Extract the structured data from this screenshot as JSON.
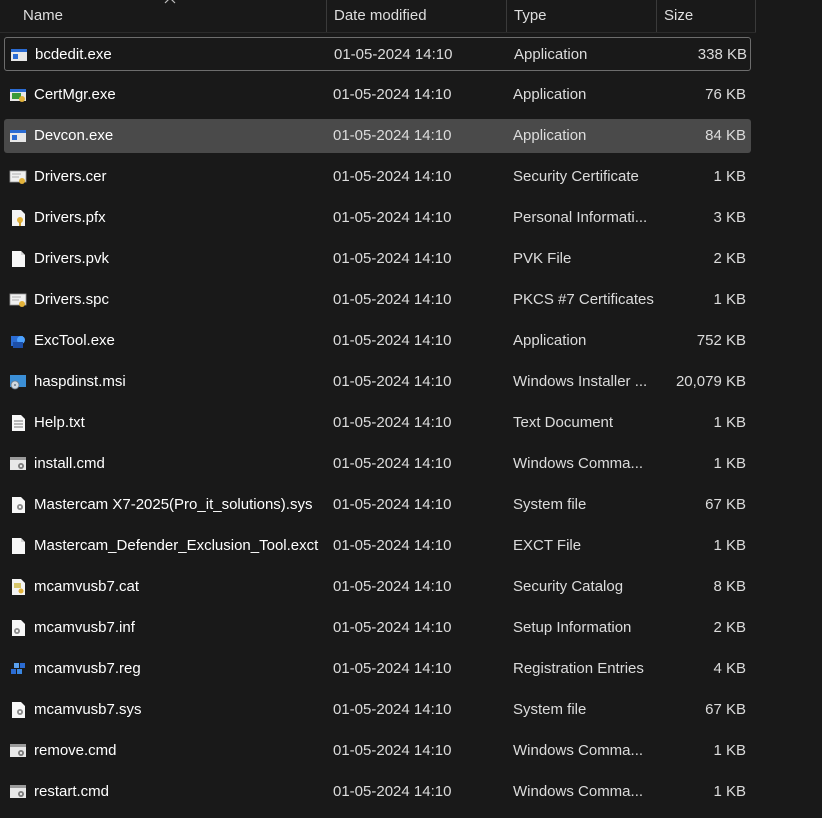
{
  "columns": {
    "name": "Name",
    "date": "Date modified",
    "type": "Type",
    "size": "Size"
  },
  "files": [
    {
      "name": "bcdedit.exe",
      "date": "01-05-2024 14:10",
      "type": "Application",
      "size": "338 KB",
      "icon": "exe-icon",
      "state": "focused"
    },
    {
      "name": "CertMgr.exe",
      "date": "01-05-2024 14:10",
      "type": "Application",
      "size": "76 KB",
      "icon": "certmgr-icon",
      "state": ""
    },
    {
      "name": "Devcon.exe",
      "date": "01-05-2024 14:10",
      "type": "Application",
      "size": "84 KB",
      "icon": "exe-icon",
      "state": "selected"
    },
    {
      "name": "Drivers.cer",
      "date": "01-05-2024 14:10",
      "type": "Security Certificate",
      "size": "1 KB",
      "icon": "certificate-icon",
      "state": ""
    },
    {
      "name": "Drivers.pfx",
      "date": "01-05-2024 14:10",
      "type": "Personal Informati...",
      "size": "3 KB",
      "icon": "pfx-icon",
      "state": ""
    },
    {
      "name": "Drivers.pvk",
      "date": "01-05-2024 14:10",
      "type": "PVK File",
      "size": "2 KB",
      "icon": "blank-file-icon",
      "state": ""
    },
    {
      "name": "Drivers.spc",
      "date": "01-05-2024 14:10",
      "type": "PKCS #7 Certificates",
      "size": "1 KB",
      "icon": "certificate-icon",
      "state": ""
    },
    {
      "name": "ExcTool.exe",
      "date": "01-05-2024 14:10",
      "type": "Application",
      "size": "752 KB",
      "icon": "exctool-icon",
      "state": ""
    },
    {
      "name": "haspdinst.msi",
      "date": "01-05-2024 14:10",
      "type": "Windows Installer ...",
      "size": "20,079 KB",
      "icon": "installer-icon",
      "state": ""
    },
    {
      "name": "Help.txt",
      "date": "01-05-2024 14:10",
      "type": "Text Document",
      "size": "1 KB",
      "icon": "text-file-icon",
      "state": ""
    },
    {
      "name": "install.cmd",
      "date": "01-05-2024 14:10",
      "type": "Windows Comma...",
      "size": "1 KB",
      "icon": "cmd-file-icon",
      "state": ""
    },
    {
      "name": "Mastercam X7-2025(Pro_it_solutions).sys",
      "date": "01-05-2024 14:10",
      "type": "System file",
      "size": "67 KB",
      "icon": "system-file-icon",
      "state": ""
    },
    {
      "name": "Mastercam_Defender_Exclusion_Tool.exct",
      "date": "01-05-2024 14:10",
      "type": "EXCT File",
      "size": "1 KB",
      "icon": "blank-file-icon",
      "state": ""
    },
    {
      "name": "mcamvusb7.cat",
      "date": "01-05-2024 14:10",
      "type": "Security Catalog",
      "size": "8 KB",
      "icon": "catalog-icon",
      "state": ""
    },
    {
      "name": "mcamvusb7.inf",
      "date": "01-05-2024 14:10",
      "type": "Setup Information",
      "size": "2 KB",
      "icon": "setup-info-icon",
      "state": ""
    },
    {
      "name": "mcamvusb7.reg",
      "date": "01-05-2024 14:10",
      "type": "Registration Entries",
      "size": "4 KB",
      "icon": "registry-icon",
      "state": ""
    },
    {
      "name": "mcamvusb7.sys",
      "date": "01-05-2024 14:10",
      "type": "System file",
      "size": "67 KB",
      "icon": "system-file-icon",
      "state": ""
    },
    {
      "name": "remove.cmd",
      "date": "01-05-2024 14:10",
      "type": "Windows Comma...",
      "size": "1 KB",
      "icon": "cmd-file-icon",
      "state": ""
    },
    {
      "name": "restart.cmd",
      "date": "01-05-2024 14:10",
      "type": "Windows Comma...",
      "size": "1 KB",
      "icon": "cmd-file-icon",
      "state": ""
    }
  ]
}
